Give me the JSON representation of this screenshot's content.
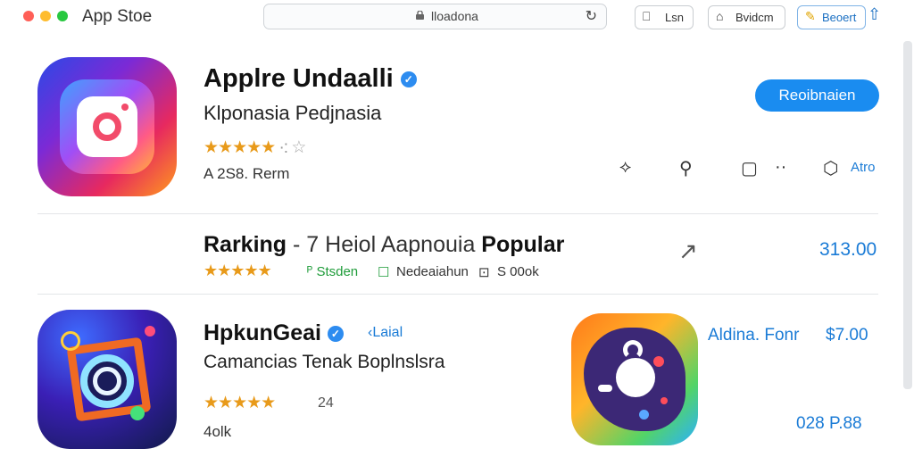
{
  "window": {
    "title": "App Stoe",
    "traffic_lights": [
      "#ff5f57",
      "#febc2e",
      "#28c840"
    ]
  },
  "toolbar": {
    "url": "lloadona",
    "btn_list": "Lsn",
    "btn_bookmark": "Bvidcm",
    "btn_report": "Beoert"
  },
  "listing1": {
    "name": "Applre Undaalli",
    "developer": "Klponasia Pedjnasia",
    "rating_filled": "★★★★★",
    "rating_dots": "·:",
    "rating_empty": "☆",
    "meta": "A 2S8. Rerm",
    "get_label": "Reoibnaien",
    "actions_label": "Atro"
  },
  "ranking": {
    "title_bold_1": "Rarking",
    "title_mid": " - 7 Heiol Aapnouia ",
    "title_bold_2": "Popular",
    "stars": "★★★★★",
    "meta_1": "ᴾ Stsden",
    "meta_2": "Nedeaiahun",
    "meta_3": "S 00ok",
    "price": "313.00"
  },
  "listing2": {
    "name": "HpkunGeai",
    "tag": "Laial",
    "developer": "Camancias Tenak Boplnslsra",
    "stars": "★★★★★",
    "rating_count": "24",
    "meta": "4olk",
    "side_name": "Aldina. Fonr",
    "side_price": "$7.00",
    "side_size": "028 P.88"
  },
  "colors": {
    "accent": "#1a8cf0",
    "star": "#e89a1a",
    "link": "#1a7bd6"
  }
}
